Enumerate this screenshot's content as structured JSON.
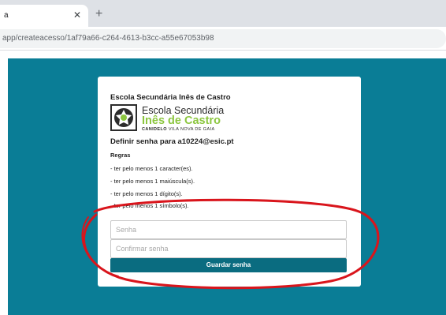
{
  "browser": {
    "tab_title": "a",
    "tab_close": "✕",
    "new_tab": "+",
    "url": "app/createacesso/1af79a66-c264-4613-b3cc-a55e67053b98"
  },
  "card": {
    "school_name": "Escola Secundária Inês de Castro",
    "logo": {
      "line1": "Escola Secundária",
      "line2": "Inês de Castro",
      "line3_bold": "CANIDELO",
      "line3_rest": " VILA NOVA DE GAIA"
    },
    "heading": "Definir senha para a10224@esic.pt",
    "rules_title": "Regras",
    "rules": [
      "- ter pelo menos 1 caracter(es).",
      "- ter pelo menos 1 maiúscula(s).",
      "- ter pelo menos 1 dígito(s).",
      "- ter pelo menos 1 símbolo(s)."
    ],
    "password_placeholder": "Senha",
    "confirm_placeholder": "Confirmar senha",
    "submit_label": "Guardar senha"
  },
  "colors": {
    "page_background": "#0a7d96",
    "button": "#0a6c80",
    "logo_green": "#8cc63f",
    "annotation": "#d9151c"
  },
  "icons": {
    "tab_close": "close-icon",
    "new_tab": "plus-icon",
    "logo": "school-emblem-icon"
  }
}
